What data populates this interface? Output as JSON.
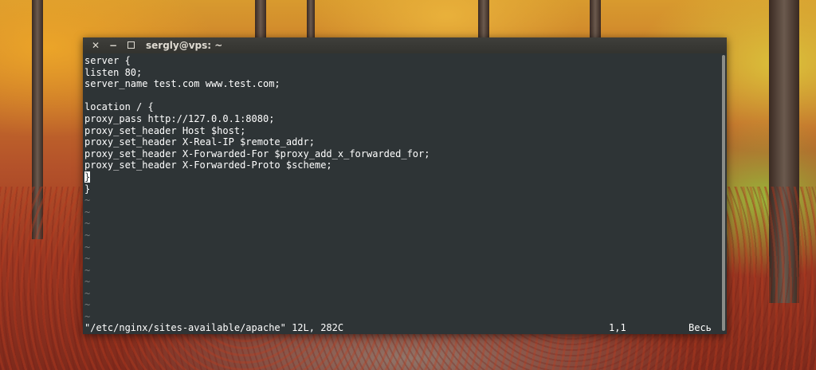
{
  "window": {
    "title": "sergly@vps: ~",
    "close_glyph": "✕",
    "minimize_glyph": "−"
  },
  "editor": {
    "lines": [
      "server {",
      "listen 80;",
      "server_name test.com www.test.com;",
      "",
      "location / {",
      "proxy_pass http://127.0.0.1:8080;",
      "proxy_set_header Host $host;",
      "proxy_set_header X-Real-IP $remote_addr;",
      "proxy_set_header X-Forwarded-For $proxy_add_x_forwarded_for;",
      "proxy_set_header X-Forwarded-Proto $scheme;",
      "}",
      "}"
    ],
    "empty_line_marker": "~",
    "empty_line_count": 11
  },
  "status": {
    "file": "\"/etc/nginx/sites-available/apache\" 12L, 282C",
    "position": "1,1",
    "scroll": "Весь"
  },
  "colors": {
    "terminal_bg": "#2e3436",
    "text": "#ffffff",
    "tilde": "#7a7a7a",
    "titlebar": "#3c3b37"
  }
}
